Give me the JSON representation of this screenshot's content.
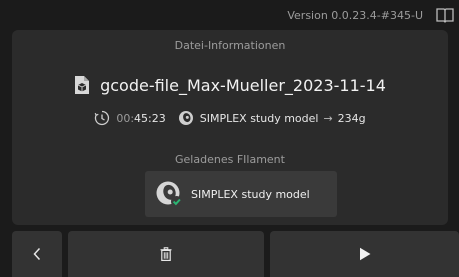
{
  "header": {
    "version": "Version 0.0.23.4-#345-U",
    "book_icon": "book-icon"
  },
  "file_info": {
    "title": "Datei-Informationen",
    "file_icon": "file-cube-icon",
    "file_name": "gcode-file_Max-Mueller_2023-11-14",
    "duration_dim": "00:",
    "duration_bright": "45:23",
    "material": "SIMPLEX study model",
    "arrow": "→",
    "weight": "234g"
  },
  "filament": {
    "title": "Geladenes FIlament",
    "name": "SIMPLEX study model",
    "status": "ok",
    "accent_color": "#2bb673"
  },
  "actions": {
    "back_icon": "chevron-left-icon",
    "delete_icon": "trash-icon",
    "play_icon": "play-icon"
  },
  "colors": {
    "background": "#1b1b1b",
    "panel": "#2b2b2b",
    "button": "#333333",
    "text_dim": "#9c9c9c"
  }
}
